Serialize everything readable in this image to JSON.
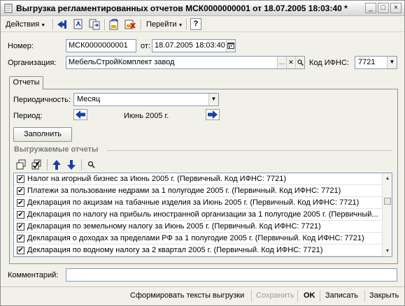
{
  "window": {
    "title": "Выгрузка регламентированных отчетов МСК0000000001 от 18.07.2005 18:03:40 *",
    "controls": [
      "_",
      "□",
      "×"
    ]
  },
  "toolbar": {
    "actions_label": "Действия",
    "goto_label": "Перейти",
    "help_label": "?"
  },
  "form": {
    "number_label": "Номер:",
    "number_value": "МСК0000000001",
    "date_label": "от:",
    "date_value": "18.07.2005 18:03:40",
    "org_label": "Организация:",
    "org_value": "МебельСтройКомплект завод",
    "ifns_label": "Код ИФНС:",
    "ifns_value": "7721",
    "comment_label": "Комментарий:",
    "comment_value": ""
  },
  "tabs": [
    {
      "label": "Отчеты"
    }
  ],
  "reports": {
    "periodicity_label": "Периодичность:",
    "periodicity_value": "Месяц",
    "period_label": "Период:",
    "period_value": "Июнь 2005 г.",
    "fill_button": "Заполнить",
    "section_title": "Выгружаемые отчеты",
    "items": [
      {
        "checked": true,
        "text": "Налог на игорный бизнес за Июнь 2005 г. (Первичный. Код ИФНС: 7721)"
      },
      {
        "checked": true,
        "text": "Платежи за пользование недрами за 1 полугодие 2005 г. (Первичный. Код ИФНС: 7721)"
      },
      {
        "checked": true,
        "text": "Декларация по акцизам на табачные изделия за Июнь 2005 г. (Первичный. Код ИФНС: 7721)"
      },
      {
        "checked": true,
        "text": "Декларация по налогу на прибыль иностранной организации за 1 полугодие 2005 г. (Первичный..."
      },
      {
        "checked": true,
        "text": "Декларация по земельному налогу за Июнь 2005 г. (Первичный. Код ИФНС: 7721)"
      },
      {
        "checked": true,
        "text": "Декларация о доходах за пределами РФ за 1 полугодие 2005 г. (Первичный. Код ИФНС: 7721)"
      },
      {
        "checked": true,
        "text": "Декларация по водному налогу за 2 квартал 2005 г. (Первичный. Код ИФНС: 7721)"
      }
    ]
  },
  "footer": {
    "generate_label": "Сформировать тексты выгрузки",
    "save_label": "Сохранить",
    "ok_label": "OK",
    "write_label": "Записать",
    "close_label": "Закрыть"
  },
  "colors": {
    "background": "#f2f1e9",
    "field_border": "#7f9db9",
    "nav_arrow_blue": "#1b3fa8"
  }
}
